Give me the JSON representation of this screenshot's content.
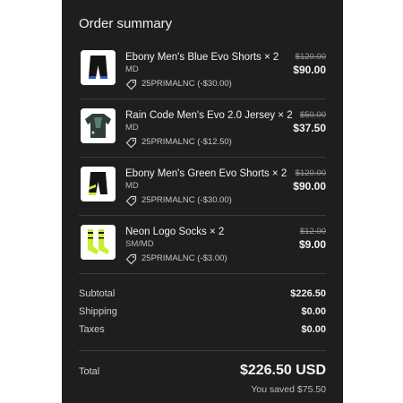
{
  "summary": {
    "title": "Order summary"
  },
  "items": [
    {
      "name": "Ebony Men's Blue Evo Shorts × 2",
      "variant": "MD",
      "discount": "25PRIMALNC (-$30.00)",
      "original_price": "$120.00",
      "final_price": "$90.00",
      "thumbnail": "shorts-blue-icon"
    },
    {
      "name": "Rain Code Men's Evo 2.0 Jersey × 2",
      "variant": "MD",
      "discount": "25PRIMALNC (-$12.50)",
      "original_price": "$50.00",
      "final_price": "$37.50",
      "thumbnail": "jersey-icon"
    },
    {
      "name": "Ebony Men's Green Evo Shorts × 2",
      "variant": "MD",
      "discount": "25PRIMALNC (-$30.00)",
      "original_price": "$120.00",
      "final_price": "$90.00",
      "thumbnail": "shorts-green-icon"
    },
    {
      "name": "Neon Logo Socks × 2",
      "variant": "SM/MD",
      "discount": "25PRIMALNC (-$3.00)",
      "original_price": "$12.00",
      "final_price": "$9.00",
      "thumbnail": "socks-icon"
    }
  ],
  "totals": {
    "subtotal_label": "Subtotal",
    "subtotal_value": "$226.50",
    "shipping_label": "Shipping",
    "shipping_value": "$0.00",
    "taxes_label": "Taxes",
    "taxes_value": "$0.00",
    "total_label": "Total",
    "total_value": "$226.50 USD",
    "saved_text": "You saved $75.50"
  },
  "colors": {
    "panel_bg": "#1e1e1e",
    "text_primary": "#f2f2f2",
    "divider": "#3a3a3a",
    "blue_accent": "#2a56c8",
    "neon_accent": "#c8f02a"
  }
}
